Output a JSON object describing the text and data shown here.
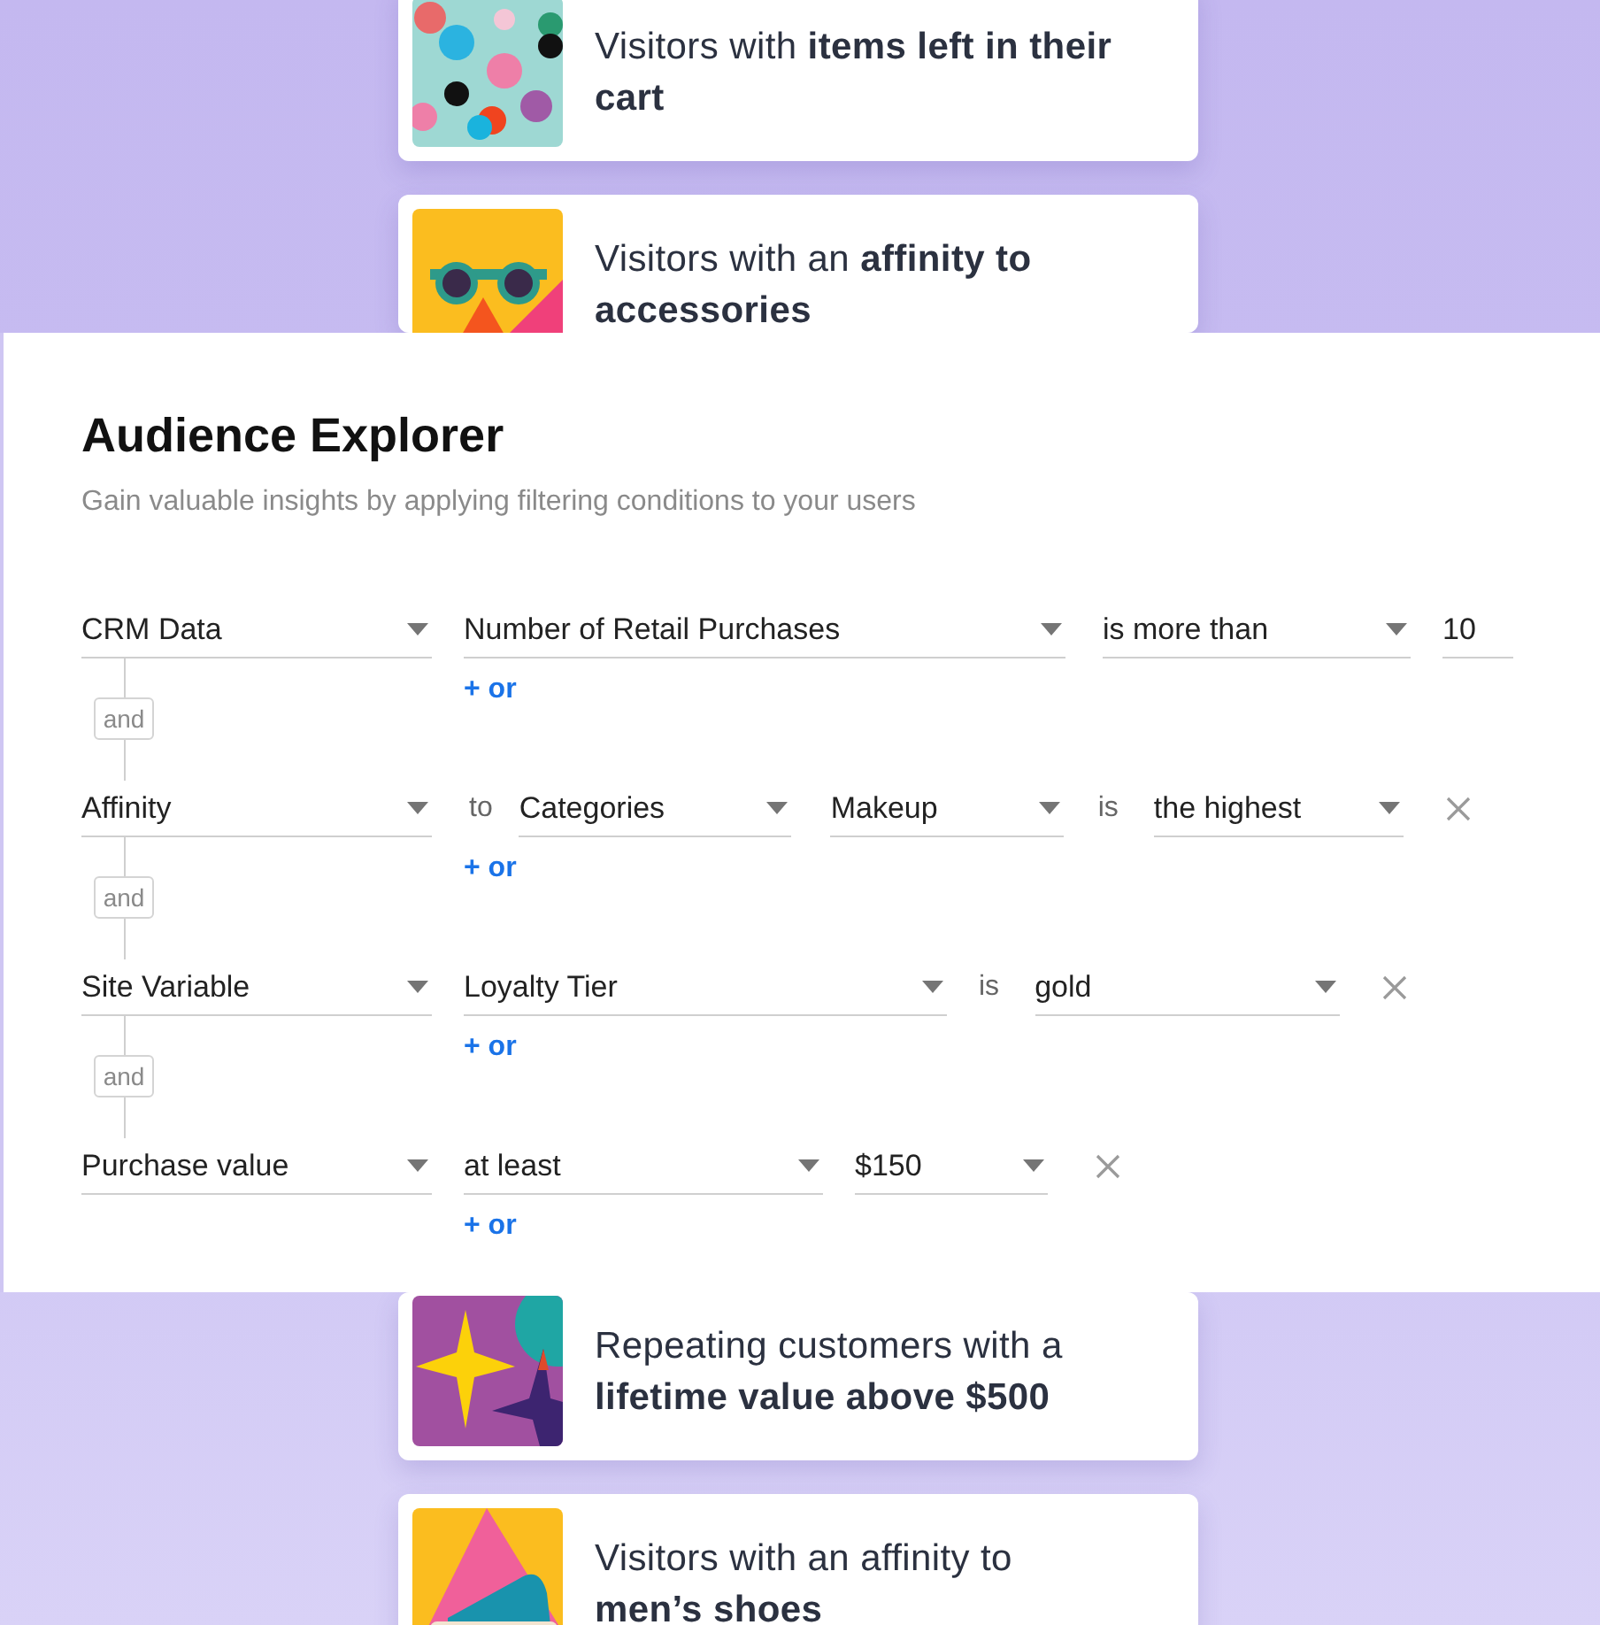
{
  "cards_top": [
    {
      "text": "Visitors with **items left in their cart**",
      "kind": "dots"
    },
    {
      "text": "Visitors with an **affinity to accessories**",
      "kind": "glasses"
    }
  ],
  "explorer": {
    "title": "Audience Explorer",
    "subtitle": "Gain valuable insights by applying filtering conditions to your users",
    "conditions": [
      {
        "fields": [
          {
            "kind": "select",
            "value": "CRM Data"
          },
          {
            "kind": "select",
            "value": "Number of Retail Purchases"
          },
          {
            "kind": "select",
            "value": "is more than"
          },
          {
            "kind": "input",
            "value": "10"
          }
        ],
        "removable": false,
        "or_link": "+ or",
        "connector": "and"
      },
      {
        "fields": [
          {
            "kind": "select",
            "value": "Affinity"
          },
          {
            "kind": "label",
            "value": "to"
          },
          {
            "kind": "select",
            "value": "Categories"
          },
          {
            "kind": "select",
            "value": "Makeup"
          },
          {
            "kind": "label",
            "value": "is"
          },
          {
            "kind": "select",
            "value": "the highest"
          }
        ],
        "removable": true,
        "or_link": "+ or",
        "connector": "and"
      },
      {
        "fields": [
          {
            "kind": "select",
            "value": "Site Variable"
          },
          {
            "kind": "select",
            "value": "Loyalty Tier"
          },
          {
            "kind": "label",
            "value": "is"
          },
          {
            "kind": "select",
            "value": "gold"
          }
        ],
        "removable": true,
        "or_link": "+ or",
        "connector": "and"
      },
      {
        "fields": [
          {
            "kind": "select",
            "value": "Purchase value"
          },
          {
            "kind": "select",
            "value": "at least"
          },
          {
            "kind": "select",
            "value": "$150"
          }
        ],
        "removable": true,
        "or_link": "+ or"
      }
    ]
  },
  "cards_bottom": [
    {
      "text": "Repeating customers with a **lifetime value above $500**",
      "kind": "stars"
    },
    {
      "text": "Visitors with an affinity to **men’s shoes**",
      "kind": "sneaker"
    }
  ]
}
